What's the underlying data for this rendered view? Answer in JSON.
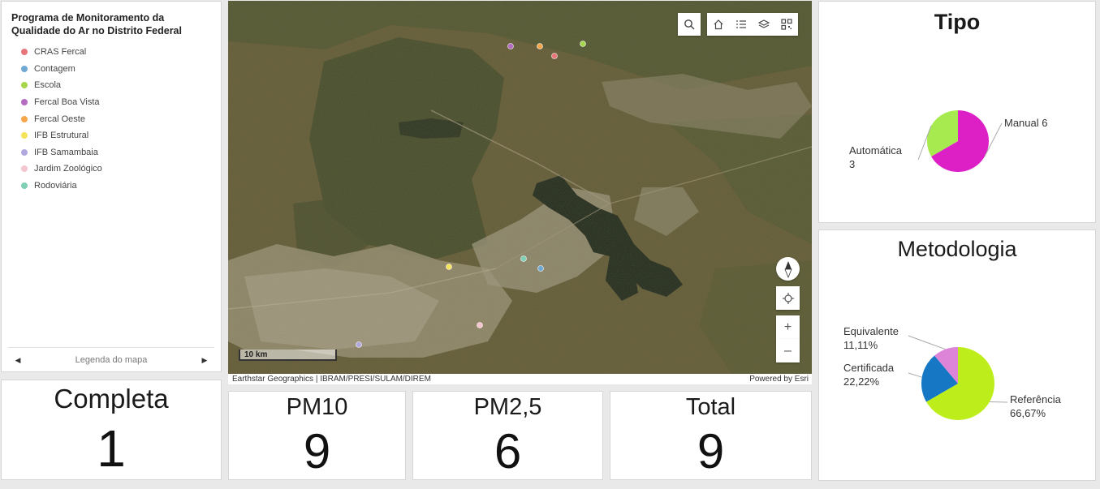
{
  "legend": {
    "title": "Programa de Monitoramento da Qualidade do Ar no Distrito Federal",
    "items": [
      {
        "label": "CRAS Fercal",
        "color": "#e8757a"
      },
      {
        "label": "Contagem",
        "color": "#6fa9d4"
      },
      {
        "label": "Escola",
        "color": "#a6d64c"
      },
      {
        "label": "Fercal Boa Vista",
        "color": "#b46cc0"
      },
      {
        "label": "Fercal Oeste",
        "color": "#f7a64c"
      },
      {
        "label": "IFB Estrutural",
        "color": "#f5e35c"
      },
      {
        "label": "IFB Samambaia",
        "color": "#b1a9dd"
      },
      {
        "label": "Jardim Zoológico",
        "color": "#f4c4cf"
      },
      {
        "label": "Rodoviária",
        "color": "#7fcfb4"
      }
    ],
    "footer_label": "Legenda do mapa",
    "prev_icon": "caret-left-icon",
    "next_icon": "caret-right-icon"
  },
  "map": {
    "scale_label": "10 km",
    "attribution_left": "Earthstar Geographics | IBRAM/PRESI/SULAM/DIREM",
    "attribution_right": "Powered by Esri",
    "toolbar": [
      "search-icon",
      "home-icon",
      "legend-list-icon",
      "layers-icon",
      "qr-code-icon"
    ],
    "controls": [
      "compass-icon",
      "locate-icon",
      "zoom-in-icon",
      "zoom-out-icon"
    ],
    "zoom_in_label": "+",
    "zoom_out_label": "–"
  },
  "indicators": {
    "completa": {
      "title": "Completa",
      "value": "1"
    },
    "pm10": {
      "title": "PM10",
      "value": "9"
    },
    "pm25": {
      "title": "PM2,5",
      "value": "6"
    },
    "total": {
      "title": "Total",
      "value": "9"
    }
  },
  "charts": {
    "tipo_title": "Tipo",
    "metodologia_title": "Metodologia"
  },
  "chart_data": [
    {
      "type": "pie",
      "title": "Tipo",
      "categories": [
        "Manual",
        "Automática"
      ],
      "values": [
        6,
        3
      ],
      "colors": [
        "#dd1fc6",
        "#a6ea4f"
      ],
      "labels": [
        "Manual 6",
        "Automática 3"
      ]
    },
    {
      "type": "pie",
      "title": "Metodologia",
      "categories": [
        "Referência",
        "Certificada",
        "Equivalente"
      ],
      "values": [
        66.67,
        22.22,
        11.11
      ],
      "colors": [
        "#bdee1b",
        "#1677c4",
        "#dd83d8"
      ],
      "labels": [
        "Referência 66,67%",
        "Certificada 22,22%",
        "Equivalente 11,11%"
      ]
    }
  ]
}
